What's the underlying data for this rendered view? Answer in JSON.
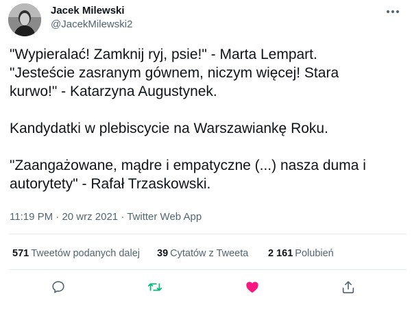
{
  "author": {
    "name": "Jacek Milewski",
    "handle": "@JacekMilewski2"
  },
  "tweet": {
    "line1": "\"Wypieralać! Zamknij ryj, psie!\" - Marta Lempart.",
    "line2": "\"Jesteście zasranym gównem, niczym więcej! Stara",
    "line3": "kurwo!\" - Katarzyna Augustynek.",
    "line4": "Kandydatki w plebiscycie na Warszawiankę Roku.",
    "line5": "\"Zaangażowane, mądre i empatyczne (...) nasza duma i",
    "line6": "autorytety\" - Rafał Trzaskowski."
  },
  "meta": {
    "time": "11:19 PM",
    "sep1": " · ",
    "date": "20 wrz 2021",
    "sep2": " · ",
    "source": "Twitter Web App"
  },
  "stats": {
    "retweets_count": "571",
    "retweets_label": "Tweetów podanych dalej",
    "quotes_count": "39",
    "quotes_label": "Cytatów z Tweeta",
    "likes_count": "2 161",
    "likes_label": "Polubień"
  },
  "icons": {
    "more": "more-icon",
    "reply": "reply-icon",
    "retweet": "retweet-icon",
    "like": "heart-icon",
    "share": "share-icon"
  },
  "colors": {
    "text": "#0f1419",
    "secondary": "#536471",
    "retweet_green": "#00ba7c",
    "like_pink": "#f91880",
    "divider": "#e1e8ed"
  }
}
